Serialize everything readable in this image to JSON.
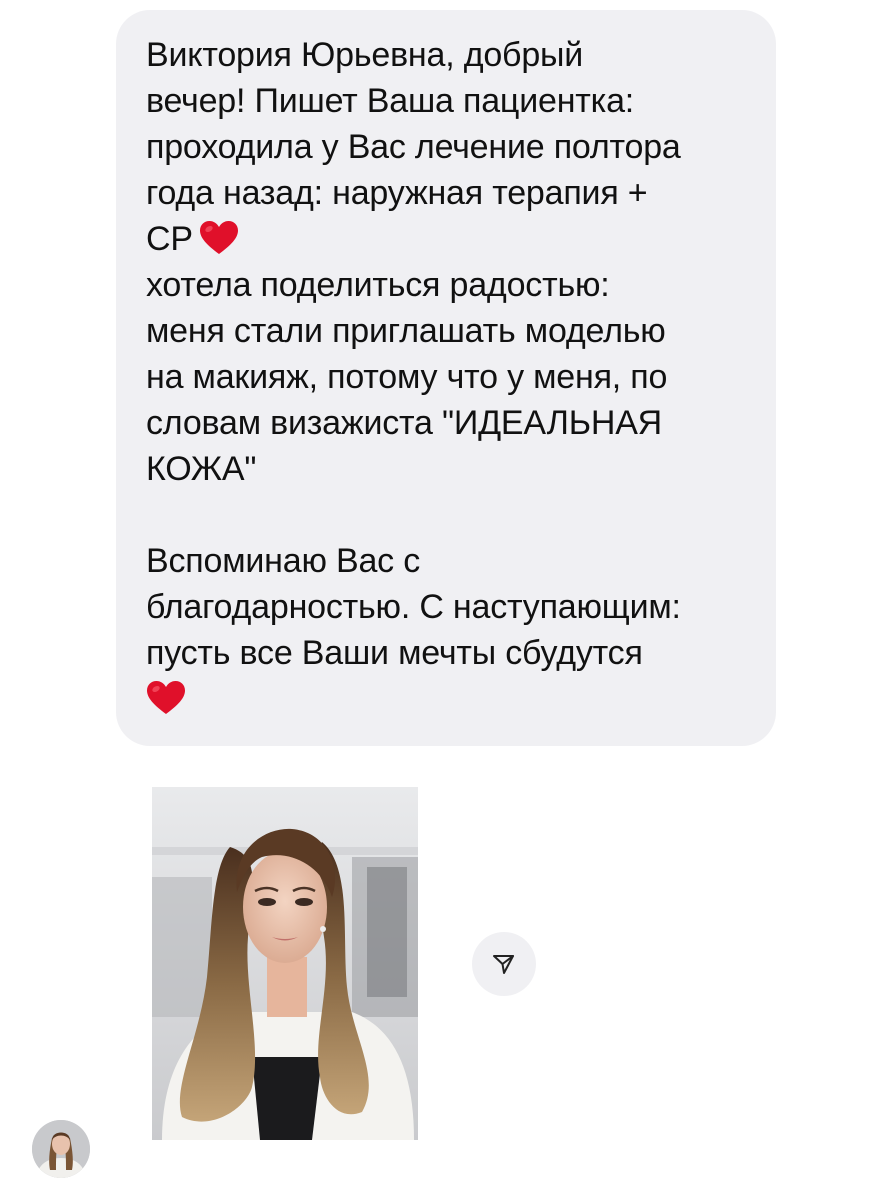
{
  "message": {
    "paragraph_1_text": "Виктория Юрьевна, добрый\nвечер! Пишет Ваша пациентка:\nпроходила у Вас лечение полтора\nгода назад: наружная терапия +\nСР",
    "paragraph_2_text": "хотела поделиться радостью:\nменя стали приглашать моделью\nна макияж, потому что у меня, по\nсловам визажиста \"ИДЕАЛЬНАЯ\nКОЖА\"",
    "paragraph_3_text": "Вспоминаю Вас с\nблагодарностью. С наступающим:\nпусть все Ваши мечты сбудутся",
    "bubble_color": "#f0f0f3",
    "heart_color": "#e0102a",
    "heart_icon": "red-heart-emoji"
  },
  "attachment": {
    "type": "photo"
  },
  "share_button": {
    "icon": "send-arrow-icon"
  },
  "sender": {
    "avatar": "user-avatar"
  }
}
